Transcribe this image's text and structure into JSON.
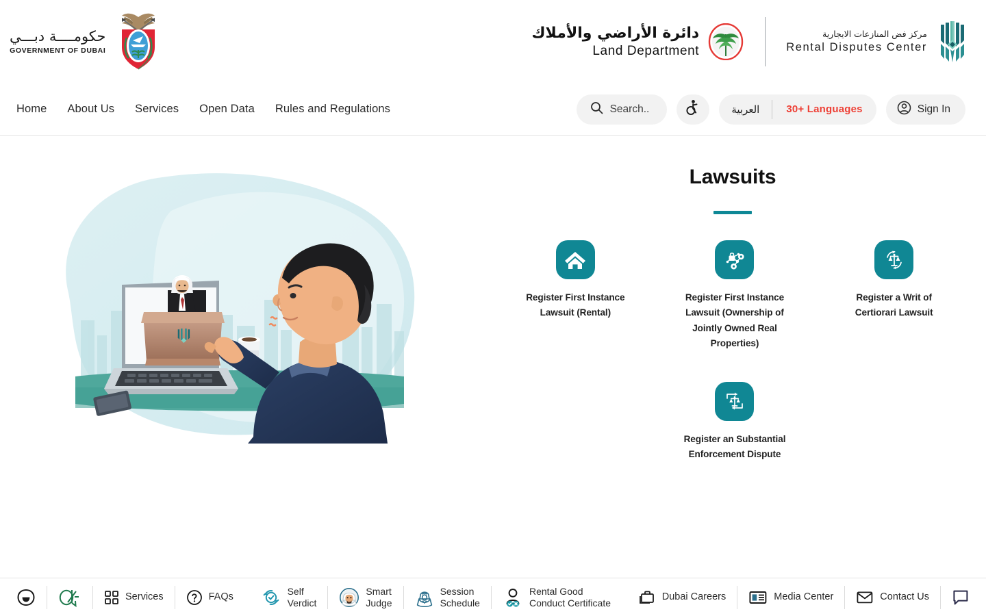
{
  "brand": {
    "government_ar": "حكومــــة دبـــي",
    "government_en": "GOVERNMENT OF DUBAI",
    "land_department_ar": "دائرة الأراضي والأملاك",
    "land_department_en": "Land Department",
    "rental_disputes_ar": "مركز فض المنازعات الايجارية",
    "rental_disputes_en": "Rental  Disputes  Center",
    "teal": "#108794",
    "red": "#ee4036",
    "green": "#1f7a4d"
  },
  "nav": {
    "links": [
      {
        "label": "Home"
      },
      {
        "label": "About Us"
      },
      {
        "label": "Services"
      },
      {
        "label": "Open Data"
      },
      {
        "label": "Rules and Regulations"
      }
    ],
    "search_label": "Search..",
    "accessibility_icon": "accessibility-icon",
    "language_arabic": "العربية",
    "language_more": "30+ Languages",
    "sign_in": "Sign In"
  },
  "hero": {
    "alt": "Illustration of a man at a laptop attending a virtual court session with a judge on screen"
  },
  "lawsuits": {
    "title": "Lawsuits",
    "tiles": [
      {
        "label": "Register First Instance Lawsuit (Rental)",
        "icon": "home-icon"
      },
      {
        "label": "Register First Instance Lawsuit (Ownership of Jointly Owned Real Properties)",
        "icon": "network-lock-icon"
      },
      {
        "label": "Register a Writ of Certiorari Lawsuit",
        "icon": "scales-refresh-icon"
      },
      {
        "label": "Register an Substantial Enforcement Dispute",
        "icon": "scales-exchange-icon"
      }
    ]
  },
  "footer": {
    "left_icons": [
      {
        "name": "happiness-meter-icon"
      },
      {
        "name": "dubai-04-logo-icon"
      }
    ],
    "items": [
      {
        "label": "Services",
        "icon": "grid-icon",
        "lines": 1
      },
      {
        "label": "FAQs",
        "icon": "question-circle-icon",
        "lines": 1
      },
      {
        "label_line1": "Self",
        "label_line2": "Verdict",
        "icon": "self-verdict-icon",
        "lines": 2
      },
      {
        "label_line1": "Smart",
        "label_line2": "Judge",
        "icon": "smart-judge-icon",
        "lines": 2
      },
      {
        "label_line1": "Session",
        "label_line2": "Schedule",
        "icon": "session-schedule-icon",
        "lines": 2
      },
      {
        "label_line1": "Rental Good",
        "label_line2": "Conduct Certificate",
        "icon": "rental-conduct-icon",
        "lines": 2
      }
    ],
    "right_items": [
      {
        "label": "Dubai Careers",
        "icon": "briefcase-icon"
      },
      {
        "label": "Media Center",
        "icon": "news-icon"
      },
      {
        "label": "Contact Us",
        "icon": "envelope-icon"
      }
    ],
    "chat_icon": "chat-bubble-icon"
  }
}
